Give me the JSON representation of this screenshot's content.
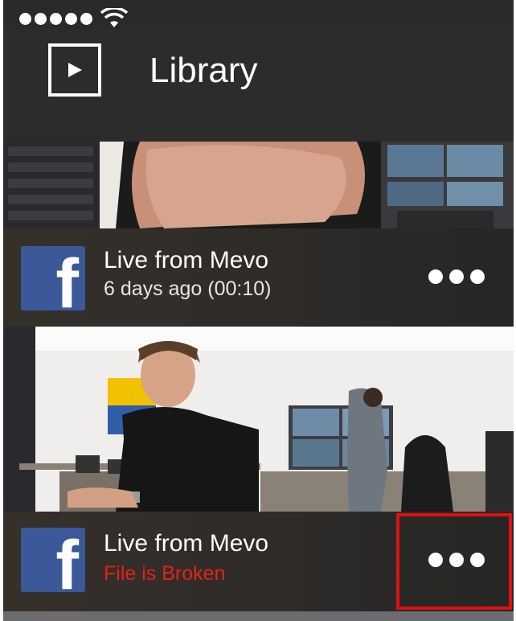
{
  "status_bar": {
    "signal_dots": 5,
    "wifi_icon": "wifi-icon"
  },
  "header": {
    "icon": "library-play-icon",
    "title": "Library"
  },
  "videos": [
    {
      "source_icon": "facebook-icon",
      "source_glyph": "f",
      "title": "Live from Mevo",
      "subtitle": "6 days ago (00:10)",
      "more_icon": "more-icon"
    },
    {
      "source_icon": "facebook-icon",
      "source_glyph": "f",
      "title": "Live from Mevo",
      "subtitle": "File is Broken",
      "subtitle_color": "#e2231a",
      "more_icon": "more-icon",
      "highlighted": true
    }
  ],
  "colors": {
    "background": "#2a2a2a",
    "facebook": "#3b5998",
    "error": "#e2231a",
    "highlight": "#e01010"
  }
}
